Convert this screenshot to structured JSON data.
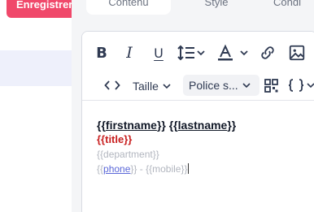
{
  "left": {
    "save_label": "Enregistrer"
  },
  "tabs": [
    "Contenu",
    "Style",
    "Condi"
  ],
  "toolbar": {
    "size_label": "Taille",
    "font_label": "Police s..."
  },
  "content": {
    "firstname": "firstname",
    "lastname": "lastname",
    "title": "{{title}}",
    "department": "{{department}}",
    "phone": "phone",
    "mobile": "{{mobile}}",
    "brace_open": "{{",
    "brace_close": "}}",
    "phone_sep": " - "
  },
  "colors": {
    "save_button": "#f0486a",
    "title_text": "#c81e1e",
    "placeholder_text": "#b2b6bf",
    "link_underline": "#5a67d8"
  }
}
